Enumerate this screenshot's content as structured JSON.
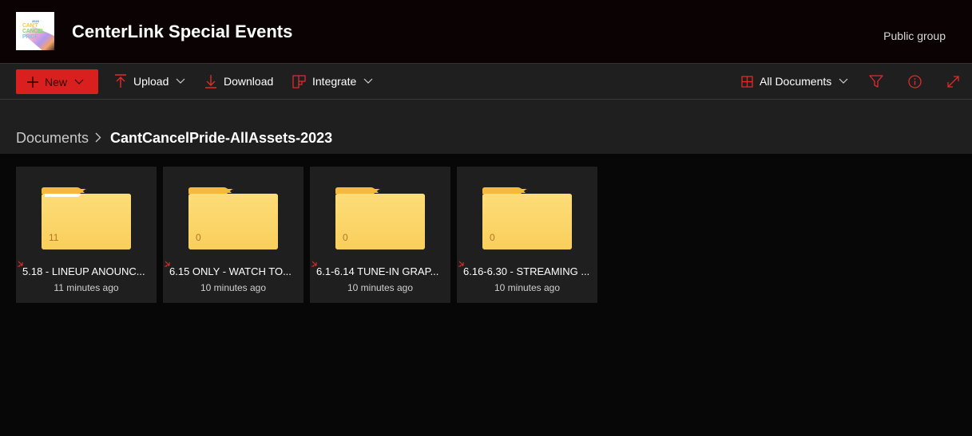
{
  "site": {
    "title": "CenterLink Special Events",
    "visibility": "Public group",
    "logo": {
      "year": "2023",
      "lines": [
        "CAN'T",
        "CANCEL",
        "PRIDE"
      ]
    }
  },
  "toolbar": {
    "new_label": "New",
    "upload_label": "Upload",
    "download_label": "Download",
    "integrate_label": "Integrate",
    "view_label": "All Documents",
    "icons": {
      "new": "plus-icon",
      "upload": "upload-arrow-icon",
      "download": "download-arrow-icon",
      "integrate": "integrate-grid-icon",
      "view": "grid-view-icon",
      "filter": "filter-icon",
      "info": "info-icon",
      "expand": "expand-icon"
    },
    "accent_color": "#e02b2b"
  },
  "breadcrumb": {
    "root": "Documents",
    "current": "CantCancelPride-AllAssets-2023"
  },
  "folders": [
    {
      "name": "5.18 - LINEUP ANOUNC...",
      "count": "11",
      "modified": "11 minutes ago",
      "has_contents": true
    },
    {
      "name": "6.15 ONLY - WATCH TO...",
      "count": "0",
      "modified": "10 minutes ago",
      "has_contents": false
    },
    {
      "name": "6.1-6.14 TUNE-IN GRAP...",
      "count": "0",
      "modified": "10 minutes ago",
      "has_contents": false
    },
    {
      "name": "6.16-6.30 - STREAMING ...",
      "count": "0",
      "modified": "10 minutes ago",
      "has_contents": false
    }
  ]
}
